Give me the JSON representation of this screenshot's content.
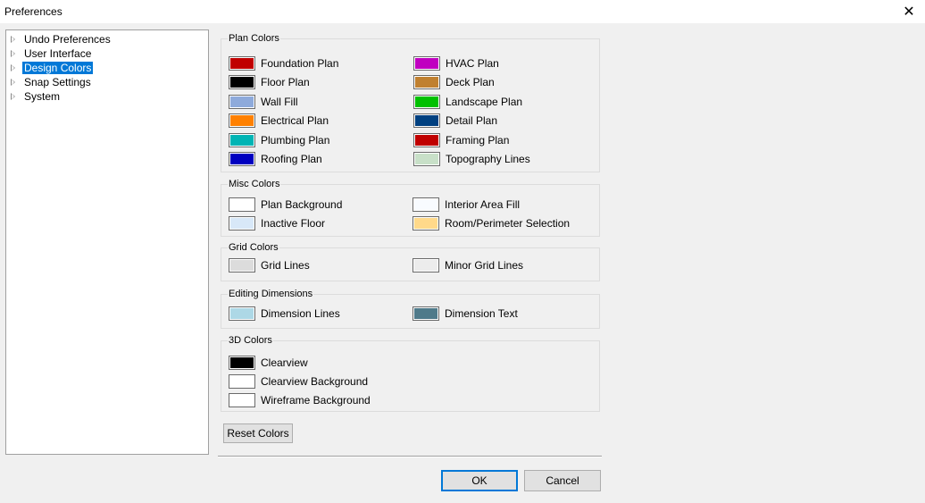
{
  "window": {
    "title": "Preferences",
    "close_glyph": "✕"
  },
  "tree": {
    "items": [
      {
        "label": "Undo Preferences",
        "selected": false
      },
      {
        "label": "User Interface",
        "selected": false
      },
      {
        "label": "Design Colors",
        "selected": true
      },
      {
        "label": "Snap Settings",
        "selected": false
      },
      {
        "label": "System",
        "selected": false
      }
    ]
  },
  "groups": {
    "plan": {
      "title": "Plan Colors",
      "left": [
        {
          "label": "Foundation Plan",
          "color": "#c00000"
        },
        {
          "label": "Floor Plan",
          "color": "#000000"
        },
        {
          "label": "Wall Fill",
          "color": "#8eaadb"
        },
        {
          "label": "Electrical Plan",
          "color": "#ff8000"
        },
        {
          "label": "Plumbing Plan",
          "color": "#00b4b4"
        },
        {
          "label": "Roofing Plan",
          "color": "#0000c0"
        }
      ],
      "right": [
        {
          "label": "HVAC Plan",
          "color": "#c000c0"
        },
        {
          "label": "Deck Plan",
          "color": "#c08030"
        },
        {
          "label": "Landscape Plan",
          "color": "#00c000"
        },
        {
          "label": "Detail Plan",
          "color": "#004080"
        },
        {
          "label": "Framing Plan",
          "color": "#c00000"
        },
        {
          "label": "Topography Lines",
          "color": "#c8e0c8"
        }
      ]
    },
    "misc": {
      "title": "Misc Colors",
      "left": [
        {
          "label": "Plan Background",
          "color": "#ffffff"
        },
        {
          "label": "Inactive Floor",
          "color": "#d8e8f8"
        }
      ],
      "right": [
        {
          "label": "Interior Area Fill",
          "color": "#f8fbff"
        },
        {
          "label": "Room/Perimeter Selection",
          "color": "#ffd98a"
        }
      ]
    },
    "grid": {
      "title": "Grid Colors",
      "left": [
        {
          "label": "Grid Lines",
          "color": "#dcdcdc"
        }
      ],
      "right": [
        {
          "label": "Minor Grid Lines",
          "color": "#ececec"
        }
      ]
    },
    "editing": {
      "title": "Editing Dimensions",
      "left": [
        {
          "label": "Dimension Lines",
          "color": "#add8e6"
        }
      ],
      "right": [
        {
          "label": "Dimension Text",
          "color": "#4f7a8a"
        }
      ]
    },
    "threed": {
      "title": "3D Colors",
      "left": [
        {
          "label": "Clearview",
          "color": "#000000"
        },
        {
          "label": "Clearview Background",
          "color": "#ffffff"
        },
        {
          "label": "Wireframe Background",
          "color": "#ffffff"
        }
      ]
    }
  },
  "buttons": {
    "reset": "Reset Colors",
    "ok": "OK",
    "cancel": "Cancel"
  }
}
